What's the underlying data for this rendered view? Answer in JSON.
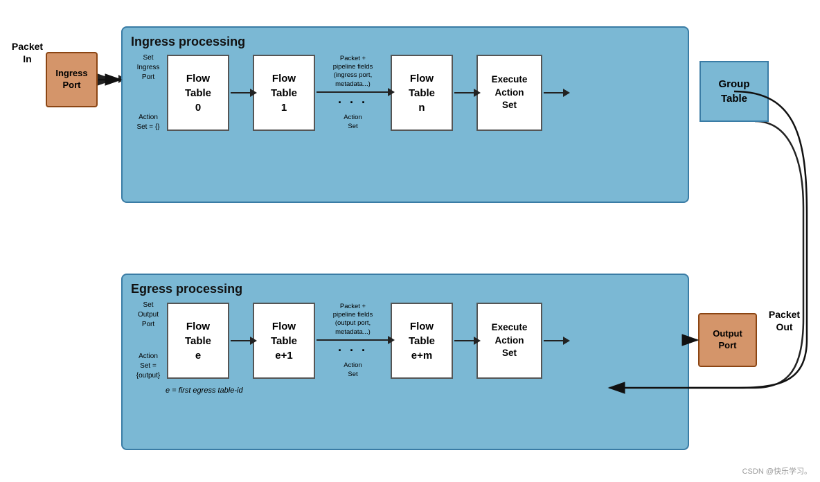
{
  "ingress": {
    "packet_in": "Packet\nIn",
    "ingress_port": "Ingress\nPort",
    "block_title": "Ingress processing",
    "annotation_left_line1": "Set",
    "annotation_left_line2": "Ingress",
    "annotation_left_line3": "Port",
    "annotation_left_action": "Action\nSet = {}",
    "flow_table_0": "Flow\nTable\n0",
    "flow_table_1": "Flow\nTable\n1",
    "flow_table_n": "Flow\nTable\nn",
    "annotation_middle": "Packet +\npipeline fields\n(ingress port,\nmetadata...)",
    "annotation_action_set": "Action\nSet",
    "execute_action_set": "Execute\nAction\nSet",
    "group_table": "Group\nTable"
  },
  "egress": {
    "block_title": "Egress processing",
    "annotation_left_line1": "Set",
    "annotation_left_line2": "Output",
    "annotation_left_line3": "Port",
    "annotation_left_action": "Action\nSet =\n{output}",
    "flow_table_e": "Flow\nTable\ne",
    "flow_table_e1": "Flow\nTable\ne+1",
    "flow_table_em": "Flow\nTable\ne+m",
    "annotation_middle": "Packet +\npipeline fields\n(output port,\nmetadata...)",
    "annotation_action_set": "Action\nSet",
    "execute_action_set": "Execute\nAction\nSet",
    "output_port": "Output\nPort",
    "packet_out": "Packet\nOut",
    "italic_note": "e = first egress table-id"
  },
  "watermark": "CSDN @快乐学习。"
}
